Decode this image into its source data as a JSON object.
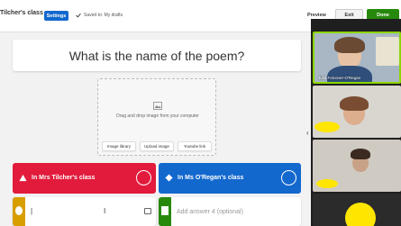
{
  "header": {
    "kahoot_title": "Tilcher's class",
    "settings_label": "Settings",
    "saved_status": "Saved to: My drafts",
    "preview_label": "Preview",
    "exit_label": "Exit",
    "done_label": "Done"
  },
  "question": {
    "text": "What is the name of the poem?"
  },
  "media": {
    "drop_text": "Drag and drop image from your computer",
    "image_library_label": "Image library",
    "upload_image_label": "Upload image",
    "youtube_link_label": "Youtube link"
  },
  "answers": [
    {
      "text": "In Mrs Tilcher's class",
      "color": "#e21b3c",
      "shape": "triangle"
    },
    {
      "text": "In Ms O'Regan's class",
      "color": "#1368ce",
      "shape": "diamond"
    },
    {
      "text": "",
      "color": "#d89e00",
      "shape": "circle"
    },
    {
      "placeholder": "Add answer 4 (optional)",
      "color": "#26890c",
      "shape": "square"
    }
  ],
  "video_call": {
    "participants": [
      {
        "name": "Julia Falconer-O'Regan"
      }
    ]
  },
  "colors": {
    "accent_blue": "#1368ce",
    "done_green": "#26890c",
    "active_speaker_border": "#8cd600"
  }
}
